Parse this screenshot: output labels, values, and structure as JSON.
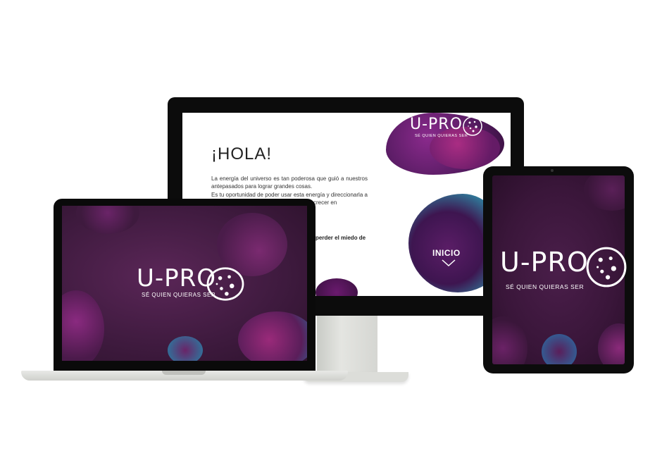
{
  "monitor": {
    "greeting": "¡HOLA!",
    "paragraph_1": "La energía del universo es tan poderosa que guió a nuestros antepasados para lograr grandes cosas.",
    "paragraph_2": "Es tu oportunidad de poder usar esta energía y direccionarla a tu ... esita, esta te ayudará ... ue puedas crecer en",
    "bold_line": "perder el miedo de",
    "logo": "U-PRO",
    "slogan": "SÉ QUIEN QUIERAS SER",
    "inicio_label": "INICIO"
  },
  "laptop": {
    "logo": "U-PRO",
    "slogan": "SÉ QUIEN QUIERAS SER"
  },
  "tablet": {
    "logo": "U-PRO",
    "slogan": "SÉ QUIEN QUIERAS SER"
  },
  "colors": {
    "brand_purple": "#3e1a3e",
    "accent_magenta": "#b52f86",
    "accent_teal": "#2aa0b6",
    "device_frame": "#0c0c0c"
  },
  "icons": {
    "logo_badge": "cookie-badge-icon",
    "inicio_arrow": "chevron-down-icon"
  }
}
